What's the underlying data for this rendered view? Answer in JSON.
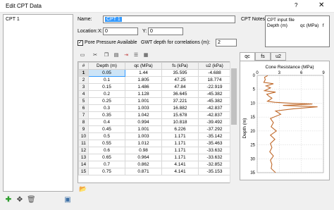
{
  "window": {
    "title": "Edit CPT Data",
    "help_glyph": "?",
    "close_glyph": "✕"
  },
  "cpt_list": {
    "items": [
      "CPT 1"
    ]
  },
  "form": {
    "name_label": "Name:",
    "name_value": "CPT 1",
    "location_label": "Location:",
    "x_label": "X:",
    "x_value": "0",
    "y_label": "Y:",
    "y_value": "0",
    "pore_pressure_label": "Pore Pressure Available",
    "pore_pressure_checked": true,
    "gwt_label": "GWT depth for correlations (m):",
    "gwt_value": "2",
    "notes_label": "CPT Notes:",
    "notes_lines": [
      "CPT input file",
      "Depth (m)          qc (MPa)   f"
    ]
  },
  "table": {
    "headers": [
      "#",
      "Depth (m)",
      "qc (MPa)",
      "fs (kPa)",
      "u2 (kPa)"
    ],
    "rows": [
      [
        "1",
        "0.05",
        "1.44",
        "35.595",
        "-4.688"
      ],
      [
        "2",
        "0.1",
        "1.805",
        "47.25",
        "18.774"
      ],
      [
        "3",
        "0.15",
        "1.486",
        "47.84",
        "-22.919"
      ],
      [
        "4",
        "0.2",
        "1.128",
        "36.645",
        "-45.382"
      ],
      [
        "5",
        "0.25",
        "1.001",
        "37.221",
        "-45.382"
      ],
      [
        "6",
        "0.3",
        "1.003",
        "16.882",
        "-42.837"
      ],
      [
        "7",
        "0.35",
        "1.042",
        "15.678",
        "-42.837"
      ],
      [
        "8",
        "0.4",
        "0.994",
        "10.818",
        "-39.492"
      ],
      [
        "9",
        "0.45",
        "1.001",
        "6.226",
        "-37.292"
      ],
      [
        "10",
        "0.5",
        "1.003",
        "1.171",
        "-35.142"
      ],
      [
        "11",
        "0.55",
        "1.012",
        "1.171",
        "-35.463"
      ],
      [
        "12",
        "0.6",
        "0.98",
        "1.171",
        "-33.632"
      ],
      [
        "13",
        "0.65",
        "0.964",
        "1.171",
        "-33.632"
      ],
      [
        "14",
        "0.7",
        "0.862",
        "4.141",
        "-32.852"
      ],
      [
        "15",
        "0.75",
        "0.871",
        "4.141",
        "-35.153"
      ]
    ]
  },
  "tabs": [
    "qc",
    "fs",
    "u2"
  ],
  "chart_data": {
    "type": "line",
    "title": "Cone Resistance (MPa)",
    "xlabel": "Cone Resistance (MPa)",
    "ylabel": "Depth (m)",
    "xlim": [
      0,
      9
    ],
    "ylim": [
      0,
      35
    ],
    "x_ticks": [
      "0",
      "3",
      "6",
      "9"
    ],
    "y_ticks": [
      "0",
      "5",
      "10",
      "15",
      "20",
      "25",
      "30",
      "35"
    ],
    "y_inverted": true,
    "grid": true,
    "color": "#c0692a",
    "series": [
      {
        "x": [
          1.44,
          1.0,
          1.1,
          0.9,
          2.2,
          1.2,
          1.8,
          1.0,
          2.5,
          1.3,
          1.6,
          2.0,
          1.7,
          1.4,
          2.4,
          4.5,
          7.5,
          3.5,
          8.2,
          5.0,
          2.5,
          3.2,
          1.8,
          2.2,
          1.9,
          2.6,
          1.8,
          2.4,
          1.8,
          2.0,
          1.7,
          2.2,
          1.8,
          2.0,
          1.9,
          2.5
        ],
        "y": [
          0.05,
          0.7,
          1.5,
          2.5,
          3.0,
          3.8,
          4.5,
          5.5,
          6.0,
          6.8,
          7.5,
          8.2,
          8.8,
          9.3,
          9.7,
          10.0,
          10.3,
          10.8,
          11.3,
          12.0,
          12.8,
          14.0,
          15.5,
          17.0,
          18.5,
          20.0,
          21.5,
          23.0,
          24.5,
          26.0,
          27.5,
          29.0,
          30.5,
          32.0,
          33.5,
          35.0
        ]
      }
    ]
  },
  "icons": {
    "toolbar": [
      "table-icon",
      "cut-icon",
      "copy-icon",
      "paste-icon",
      "insert-row-icon",
      "delete-row-icon",
      "append-icon"
    ],
    "bottom": [
      "add-icon",
      "move-icon",
      "delete-icon",
      "properties-icon"
    ]
  }
}
